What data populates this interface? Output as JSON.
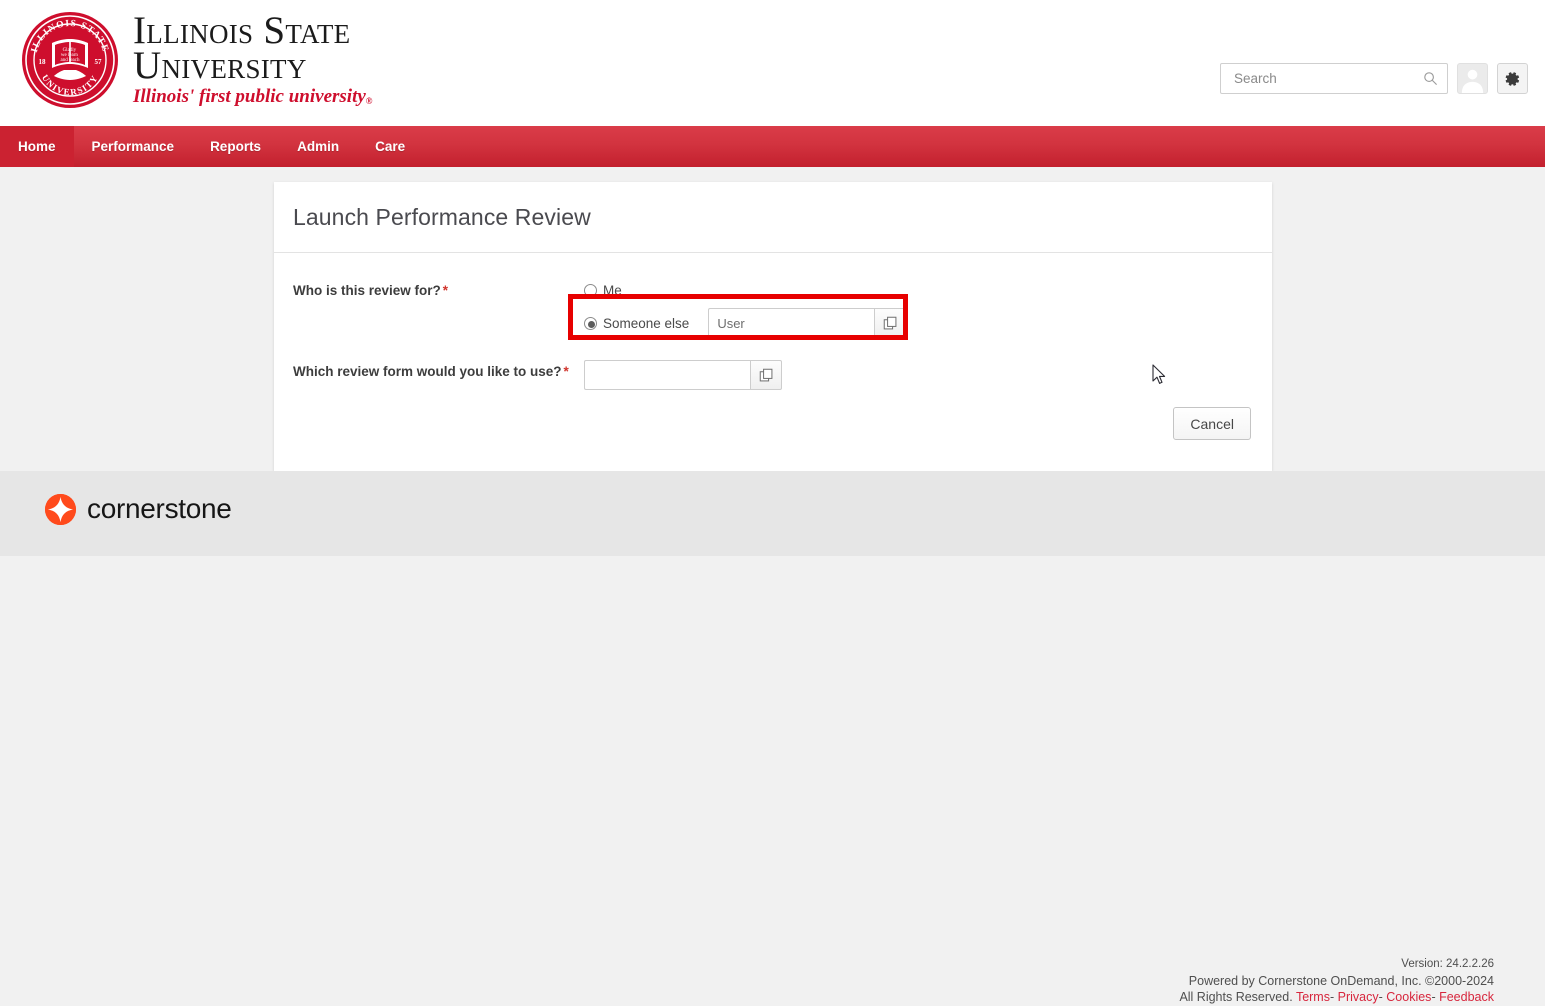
{
  "header": {
    "brand": {
      "line1": "Illinois State",
      "line2": "University",
      "tagline": "Illinois' first public university",
      "tagline_mark": "®",
      "seal_text_top": "ILLINOIS STATE",
      "seal_text_bottom": "UNIVERSITY",
      "seal_motto": "Gladly we learn and teach",
      "seal_year_left": "18",
      "seal_year_right": "57"
    },
    "search": {
      "value": "",
      "placeholder": "Search",
      "icon": "search-icon"
    },
    "avatar_icon": "user-avatar-icon",
    "settings_icon": "gear-icon"
  },
  "nav": {
    "items": [
      {
        "label": "Home",
        "active": true
      },
      {
        "label": "Performance",
        "active": false
      },
      {
        "label": "Reports",
        "active": false
      },
      {
        "label": "Admin",
        "active": false
      },
      {
        "label": "Care",
        "active": false
      }
    ]
  },
  "panel": {
    "title": "Launch Performance Review",
    "fields": [
      {
        "label": "Who is this review for?",
        "required_mark": "*",
        "options": [
          {
            "label": "Me",
            "selected": false
          },
          {
            "label": "Someone else",
            "selected": true
          }
        ],
        "lookup": {
          "value": "User",
          "placeholder": "",
          "icon": "select-popup-icon"
        }
      },
      {
        "label": "Which review form would you like to use?",
        "required_mark": "*",
        "lookup": {
          "value": "",
          "placeholder": "",
          "icon": "select-popup-icon"
        }
      }
    ],
    "cancel_label": "Cancel"
  },
  "footer": {
    "logo_word": "cornerstone",
    "version": "Version: 24.2.2.26",
    "powered_by": "Powered by Cornerstone OnDemand, Inc. ©2000-2024",
    "rights": "All Rights Reserved.",
    "links": [
      {
        "label": "Terms"
      },
      {
        "label": "Privacy"
      },
      {
        "label": "Cookies"
      },
      {
        "label": "Feedback"
      }
    ],
    "separator": "-"
  },
  "annotation": {
    "highlight_color": "#e70000"
  }
}
